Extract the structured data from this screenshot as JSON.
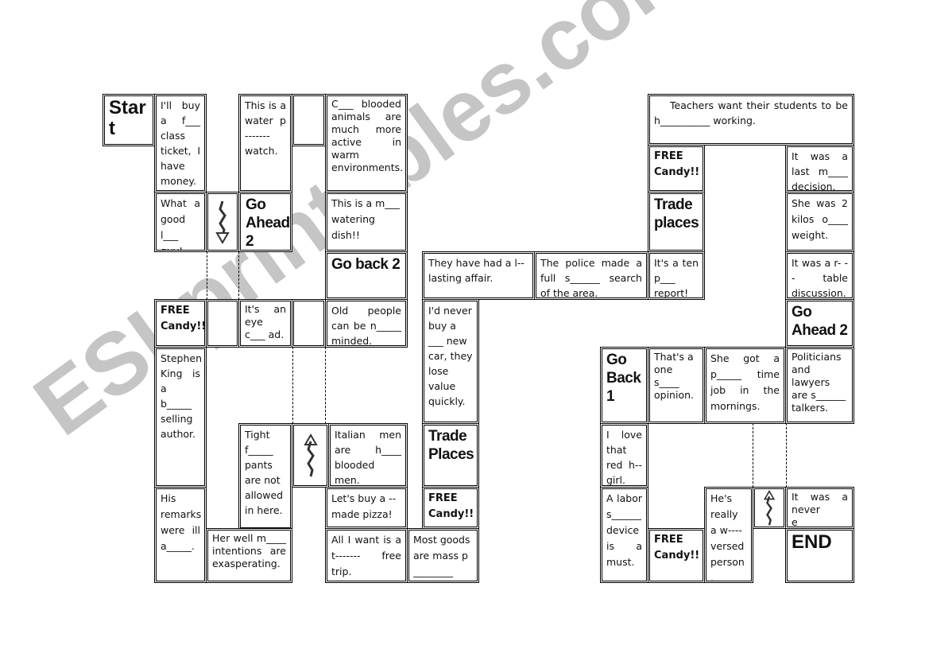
{
  "cells": [
    "Star t",
    "I'll buy a f___ class ticket, I have money.",
    "This is a water p ------- watch.",
    "",
    "C___ blooded animals are much more active in warm environments.",
    "What a good l___ guy!",
    "Go Ahead 2",
    "This is a m___ watering dish!!",
    "Go back 2",
    "FREE Candy!!",
    "",
    "It's an eye c___ ad.",
    "",
    "Old people can be n_____ minded.",
    "Stephen King is a b_____ selling author.",
    "Tight f_____ pants are not allowed in here.",
    "Italian men are h____ blooded men.",
    "His remarks were ill a_____.",
    "Her well m____ intentions are exasperating.",
    "Let's buy a -- made pizza!",
    "All I want is a t------- free trip.",
    "Most goods are mass p ________",
    "I'd never buy a ___ new car, they lose value quickly.",
    "Trade Places",
    "FREE Candy!!",
    "They have had a l-- lasting affair.",
    "The police made a full s______ search of the area.",
    "It's a ten p___ report!",
    "Teachers want their students to be h__________ working.",
    "FREE Candy!!",
    "Trade places",
    "It was a last m____ decision.",
    "She was 2 kilos o____ weight.",
    "It was a r- -- table discussion.",
    "Go Ahead 2",
    "Go Back 1",
    "That's a one s____ opinion.",
    "She got a p_____ time job in the mornings.",
    "Politicians and lawyers are s______ talkers.",
    "I love that red h-- girl.",
    "A labor s______ device is a must.",
    "FREE Candy!!",
    "He's really a w---- versed person .",
    "It was a never e____ argument.",
    "END"
  ],
  "arrows": [
    "arrow-down-icon",
    "arrow-up-icon",
    "arrow-up-icon"
  ],
  "watermark": "ESLprintables.com"
}
